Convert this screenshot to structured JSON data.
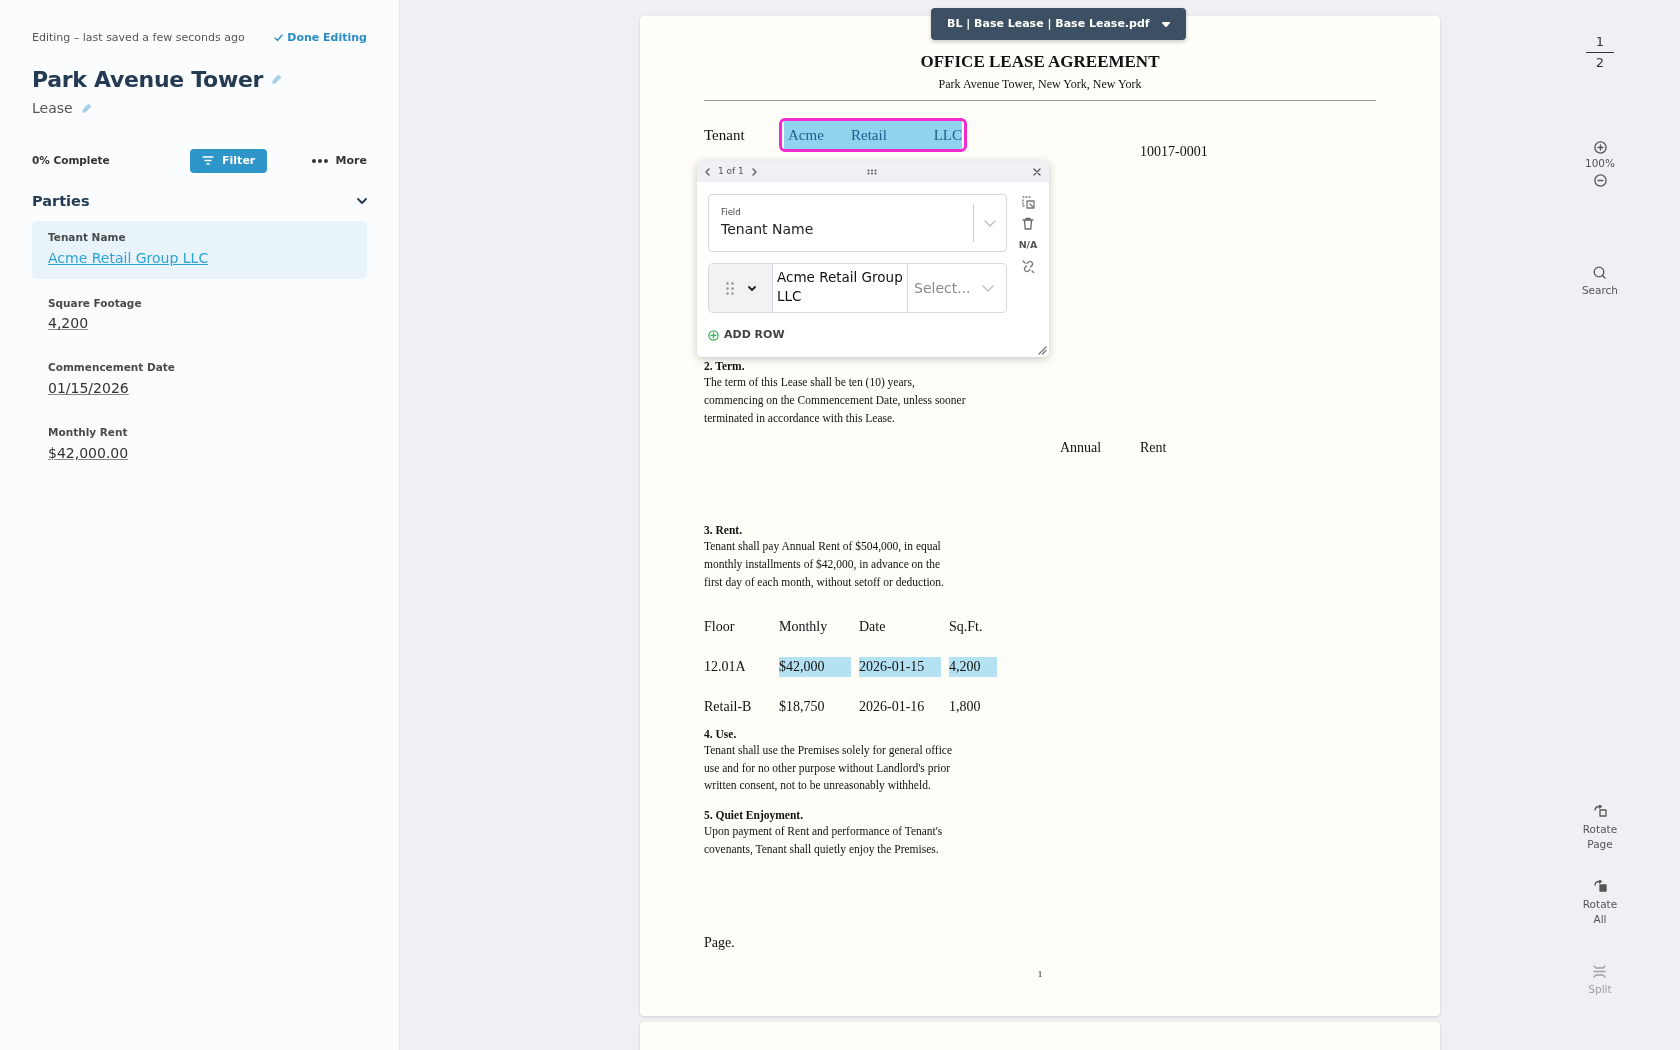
{
  "sidebar": {
    "status": "Editing – last saved a few seconds ago",
    "done_button": "Done Editing",
    "title": "Park Avenue Tower",
    "subtitle": "Lease",
    "progress": "0% Complete",
    "filter_button": "Filter",
    "more_button": "More",
    "section": {
      "title": "Parties",
      "expanded": true,
      "fields": [
        {
          "label": "Tenant Name",
          "value": "Acme Retail Group LLC",
          "selected": true
        },
        {
          "label": "Square Footage",
          "value": "4,200",
          "selected": false
        },
        {
          "label": "Commencement Date",
          "value": "01/15/2026",
          "selected": false
        },
        {
          "label": "Monthly Rent",
          "value": "$42,000.00",
          "selected": false
        }
      ]
    }
  },
  "document": {
    "selector": "BL | Base Lease | Base Lease.pdf",
    "title": "OFFICE LEASE AGREEMENT",
    "subtitle": "Park Avenue Tower, New York, New York",
    "tenant_label": "Tenant",
    "tenant_words": [
      {
        "text": "Acme",
        "highlighted": true
      },
      {
        "text": "Retail",
        "highlighted": true
      },
      {
        "text": "LLC",
        "highlighted": true
      }
    ],
    "zip": "10017-0001",
    "term": {
      "heading": "2. Term.",
      "lines": [
        "The term of this Lease shall be ten (10) years,",
        "commencing on the Commencement Date, unless sooner",
        "terminated in accordance with this Lease."
      ]
    },
    "header_words": [
      "Annual",
      "Rent"
    ],
    "sections_before_table": [
      {
        "heading": "3. Rent.",
        "lines": [
          "Tenant shall pay Annual Rent of $504,000, in equal",
          "monthly installments of $42,000, in advance on the",
          "first day of each month, without setoff or deduction."
        ]
      }
    ],
    "table": {
      "columns": [
        "Floor",
        "Monthly",
        "Date",
        "Sq.Ft."
      ],
      "rows": [
        {
          "cells": [
            {
              "text": "12.01A",
              "highlighted": false
            },
            {
              "text": "$42,000",
              "highlighted": true
            },
            {
              "text": "2026-01-15",
              "highlighted": true
            },
            {
              "text": "4,200",
              "highlighted": true
            }
          ]
        },
        {
          "cells": [
            {
              "text": "Retail-B",
              "highlighted": false
            },
            {
              "text": "$18,750",
              "highlighted": false
            },
            {
              "text": "2026-01-16",
              "highlighted": false
            },
            {
              "text": "1,800",
              "highlighted": false
            }
          ]
        }
      ]
    },
    "sections_after_table": [
      {
        "heading": "4. Use.",
        "lines": [
          "Tenant shall use the Premises solely for general office",
          "use and for no other purpose without Landlord's prior",
          "written consent, not to be unreasonably withheld."
        ]
      },
      {
        "heading": "5. Quiet Enjoyment.",
        "lines": [
          "Upon payment of Rent and performance of Tenant's",
          "covenants, Tenant shall quietly enjoy the Premises."
        ]
      }
    ],
    "footer_text": "Page.",
    "page_number": "1"
  },
  "popup": {
    "pager": "1 of 1",
    "field_label": "Field",
    "field_value": "Tenant Name",
    "row_value": "Acme Retail Group LLC",
    "select_placeholder": "Select...",
    "na_label": "N/A",
    "add_row": "ADD ROW"
  },
  "toolbar": {
    "current_page": "1",
    "total_pages": "2",
    "zoom": "100%",
    "items": [
      {
        "kind": "search",
        "label": "Search",
        "disabled": false
      },
      {
        "kind": "rotate-page",
        "label": "Rotate Page",
        "disabled": false
      },
      {
        "kind": "rotate-all",
        "label": "Rotate All",
        "disabled": false
      },
      {
        "kind": "split",
        "label": "Split",
        "disabled": true
      }
    ]
  }
}
